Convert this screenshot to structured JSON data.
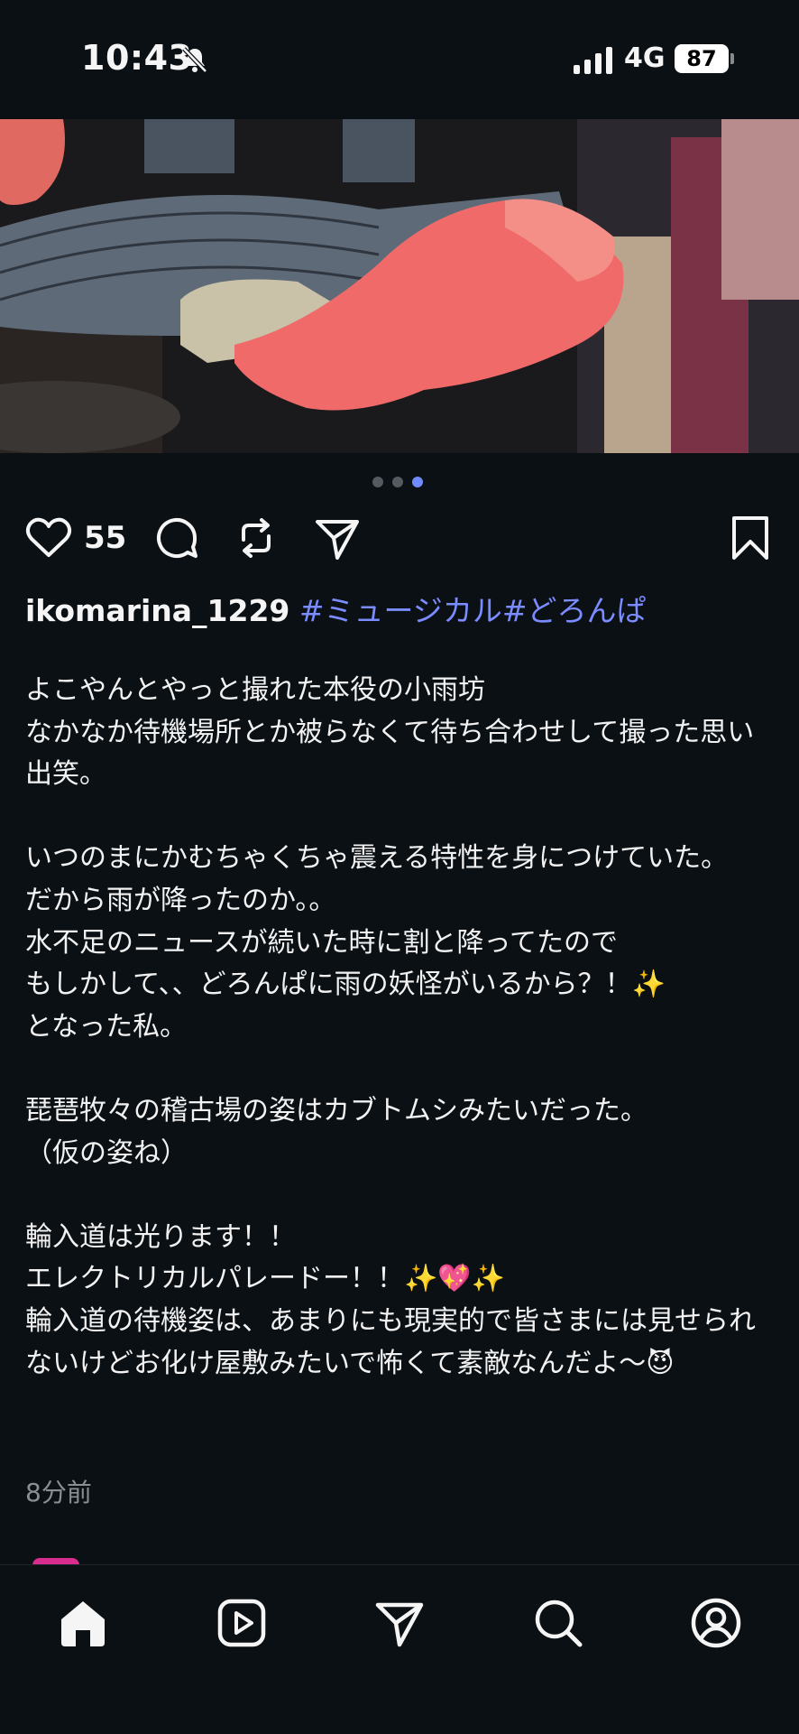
{
  "status_bar": {
    "time": "10:43",
    "network": "4G",
    "battery": "87"
  },
  "carousel": {
    "count": 3,
    "active_index": 2
  },
  "actions": {
    "like_count": "55"
  },
  "post": {
    "username": "ikomarina_1229",
    "hashtags": "#ミュージカル#どろんぱ",
    "body": "よこやんとやっと撮れた本役の小雨坊\nなかなか待機場所とか被らなくて待ち合わせして撮った思い出笑。\n\nいつのまにかむちゃくちゃ震える特性を身につけていた。\nだから雨が降ったのか。。\n水不足のニュースが続いた時に割と降ってたので\nもしかして、、どろんぱに雨の妖怪がいるから？！✨\nとなった私。\n\n琵琶牧々の稽古場の姿はカブトムシみたいだった。\n（仮の姿ね）\n\n輪入道は光ります！！\nエレクトリカルパレードー！！✨💖✨\n輪入道の待機姿は、あまりにも現実的で皆さまには見せられないけどお化け屋敷みたいで怖くて素敵なんだよ〜😈",
    "timestamp": "8分前"
  },
  "colors": {
    "background": "#0b1014",
    "hashtag": "#7a8cff",
    "active_dot": "#6f8bff",
    "timestamp": "#8a8f95"
  },
  "tab_bar": {
    "tabs": [
      "home-icon",
      "reels-icon",
      "send-icon",
      "search-icon",
      "profile-icon"
    ],
    "active": "home-icon"
  }
}
